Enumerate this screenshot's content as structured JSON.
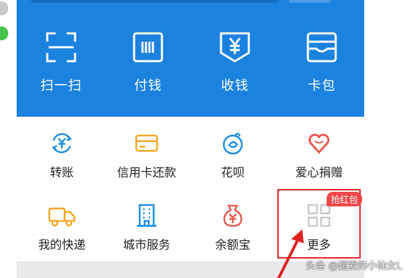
{
  "quick_actions": [
    {
      "label": "扫一扫",
      "icon": "scan-icon"
    },
    {
      "label": "付钱",
      "icon": "pay-barcode-icon"
    },
    {
      "label": "收钱",
      "icon": "receive-money-icon"
    },
    {
      "label": "卡包",
      "icon": "card-wallet-icon"
    }
  ],
  "services": [
    {
      "label": "转账",
      "icon": "transfer-icon"
    },
    {
      "label": "信用卡还款",
      "icon": "credit-card-icon"
    },
    {
      "label": "花呗",
      "icon": "huabei-icon"
    },
    {
      "label": "爱心捐赠",
      "icon": "heart-donation-icon"
    },
    {
      "label": "我的快递",
      "icon": "delivery-truck-icon"
    },
    {
      "label": "城市服务",
      "icon": "city-building-icon"
    },
    {
      "label": "余额宝",
      "icon": "money-bag-icon"
    },
    {
      "label": "更多",
      "icon": "more-grid-icon"
    }
  ],
  "badge": {
    "text": "抢红包"
  },
  "watermark": {
    "text": "头条 @超爱的小仙女L"
  },
  "colors": {
    "header_blue": "#1b82e0",
    "highlight_red": "#e02020",
    "icon_blue": "#1a8ee6",
    "icon_orange": "#f5a623",
    "icon_red": "#e85a4f",
    "icon_gray": "#c8c8c8"
  }
}
